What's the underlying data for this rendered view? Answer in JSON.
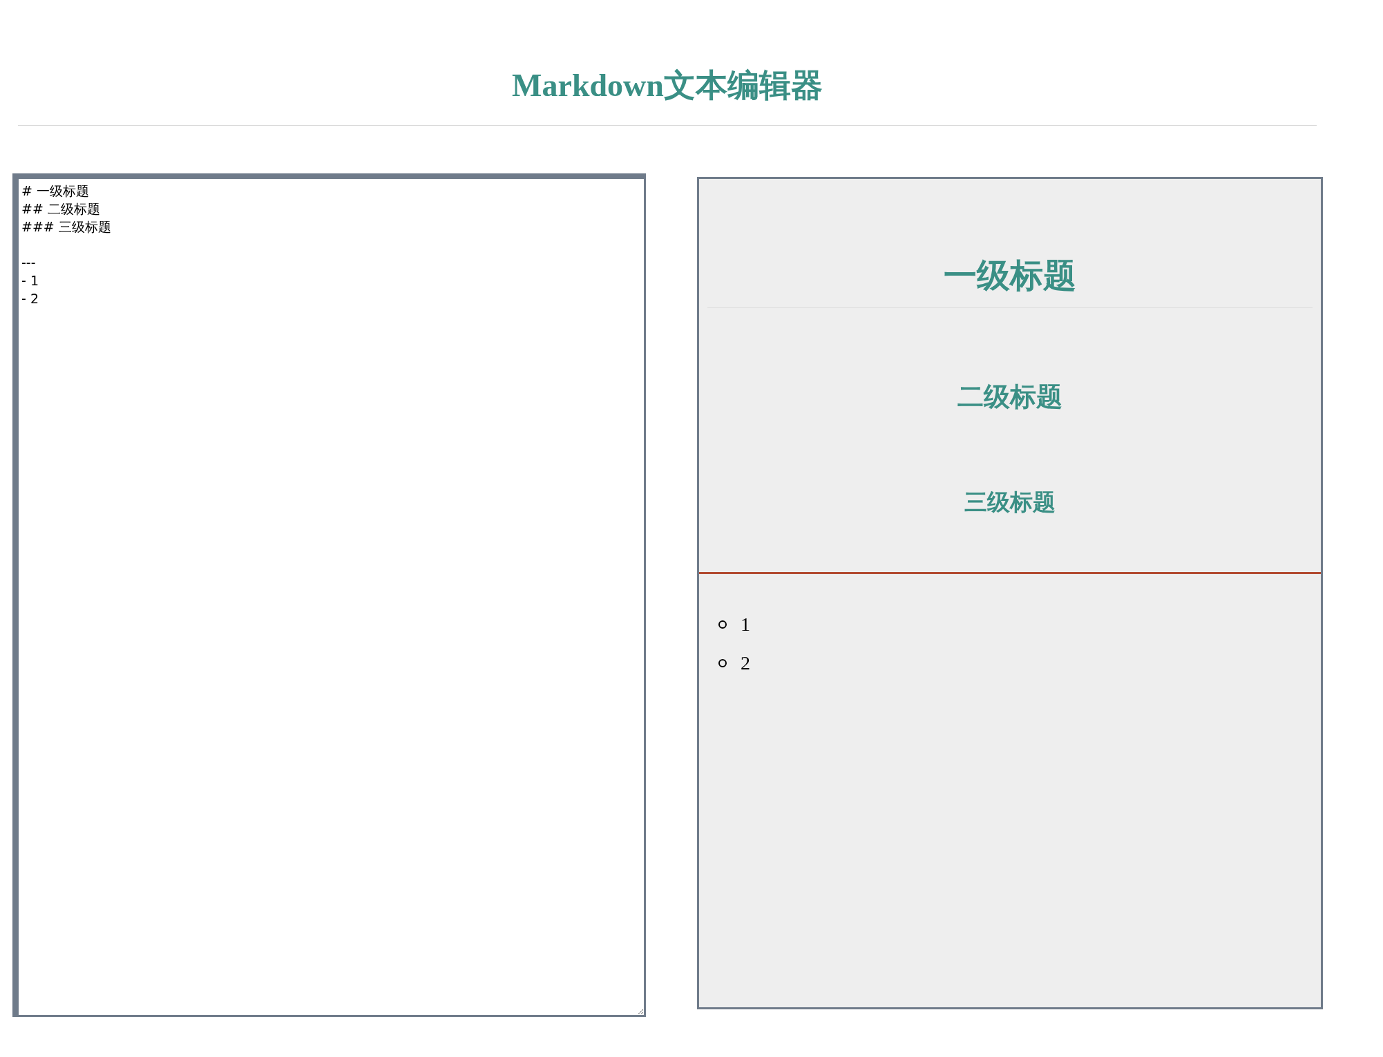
{
  "title": "Markdown文本编辑器",
  "editor": {
    "value": "# 一级标题\n## 二级标题\n### 三级标题\n\n---\n- 1\n- 2"
  },
  "preview": {
    "blocks": [
      {
        "kind": "h1",
        "text": "一级标题"
      },
      {
        "kind": "h2",
        "text": "二级标题"
      },
      {
        "kind": "h3",
        "text": "三级标题"
      },
      {
        "kind": "hr"
      },
      {
        "kind": "ul",
        "items": [
          "1",
          "2"
        ]
      }
    ]
  }
}
